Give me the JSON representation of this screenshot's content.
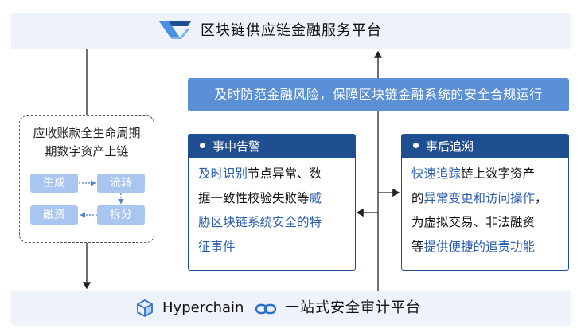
{
  "top": {
    "title": "区块链供应链金融服务平台"
  },
  "goal": {
    "text": "及时防范金融风险，保障区块链金融系统的安全合规运行"
  },
  "lifecycle": {
    "title_line1": "应收账款全生命周期",
    "title_line2": "期数字资产上链",
    "chips": {
      "generate": "生成",
      "transfer": "流转",
      "finance": "融资",
      "split": "拆分"
    }
  },
  "alert_card": {
    "title": "事中告警",
    "line1": {
      "a": "及时识别",
      "b": "节点异常、数"
    },
    "line2": {
      "a": "据一致性校验失败等",
      "b": "威"
    },
    "line3": {
      "a": "胁区块链系统安全的特"
    },
    "line4": {
      "a": "征事件"
    }
  },
  "trace_card": {
    "title": "事后追溯",
    "line1": {
      "a": "快速追踪",
      "b": "链上数字资产"
    },
    "line2": {
      "a": "的",
      "b": "异常变更和访问操作",
      "c": "，"
    },
    "line3": {
      "a": "为虚拟交易、非法融资"
    },
    "line4": {
      "a": "等",
      "b": "提供便捷的追责功能"
    }
  },
  "bottom": {
    "product": "Hyperchain",
    "title": "一站式安全审计平台"
  },
  "icons": [
    "chevron-logo-icon",
    "cube-icon",
    "chain-link-icon",
    "dot-icon"
  ],
  "colors": {
    "navy": "#1f4e91",
    "goal_blue": "#5b8fd6",
    "chip_blue": "#a8c6f0",
    "banner_bg": "#eef3fb",
    "highlight": "#2a5db0"
  }
}
